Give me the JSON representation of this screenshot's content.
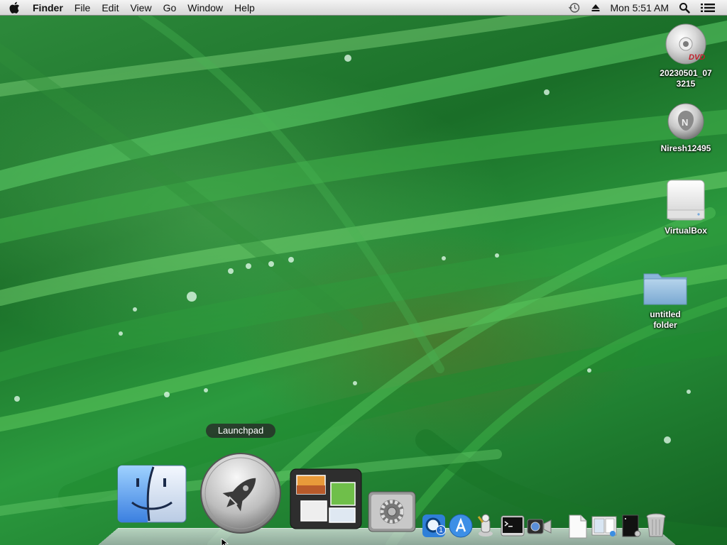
{
  "menubar": {
    "apple_icon": "apple-icon",
    "app_name": "Finder",
    "menus": [
      "File",
      "Edit",
      "View",
      "Go",
      "Window",
      "Help"
    ],
    "status": {
      "time_machine_icon": "time-machine-icon",
      "eject_icon": "eject-icon",
      "clock": "Mon 5:51 AM",
      "spotlight_icon": "spotlight-icon",
      "notifications_icon": "list-icon"
    }
  },
  "desktop": {
    "icons": [
      {
        "label_line1": "20230501_07",
        "label_line2": "3215",
        "icon": "dvd-icon"
      },
      {
        "label_line1": "Niresh12495",
        "label_line2": "",
        "icon": "install-disk-icon"
      },
      {
        "label_line1": "VirtualBox",
        "label_line2": "",
        "icon": "external-drive-icon"
      },
      {
        "label_line1": "untitled",
        "label_line2": "folder",
        "icon": "folder-icon"
      }
    ]
  },
  "dock": {
    "tooltip": "Launchpad",
    "items": [
      "finder-icon",
      "launchpad-icon",
      "mission-control-icon",
      "system-preferences-icon",
      "quicktime-icon",
      "app-store-icon",
      "automator-icon",
      "terminal-icon",
      "facetime-icon",
      "document-icon",
      "preview-icon",
      "dark-file-icon",
      "trash-icon"
    ],
    "badge_count": "1"
  }
}
